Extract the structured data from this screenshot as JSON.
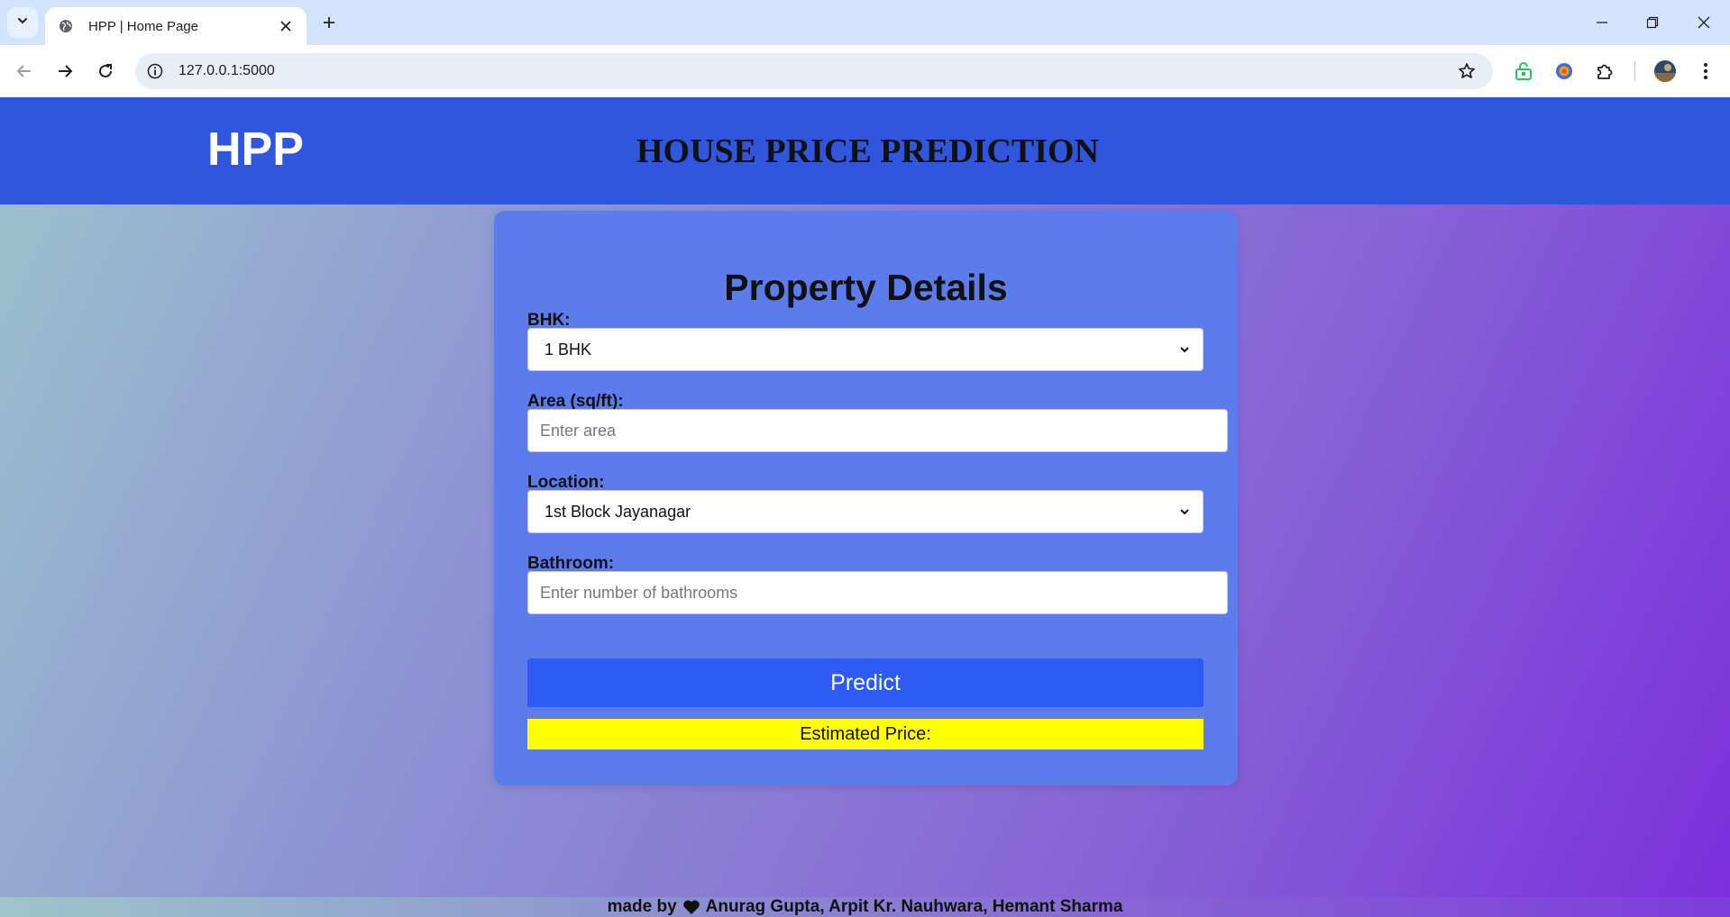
{
  "browser": {
    "tab_title": "HPP | Home Page",
    "url": "127.0.0.1:5000",
    "icons": [
      "tab-search-icon",
      "globe-icon",
      "close-icon",
      "plus-icon",
      "minimize-icon",
      "restore-icon",
      "window-close-icon",
      "back-arrow-icon",
      "forward-arrow-icon",
      "reload-icon",
      "site-info-icon",
      "star-icon",
      "lock-extension-icon",
      "colorful-extension-icon",
      "puzzle-icon",
      "avatar",
      "kebab-menu-icon"
    ]
  },
  "header": {
    "logo": "HPP",
    "title": "HOUSE PRICE PREDICTION",
    "bg_color": "#2f56dd"
  },
  "form": {
    "heading": "Property Details",
    "bhk_label": "BHK:",
    "bhk_value": "1 BHK",
    "area_label": "Area (sq/ft):",
    "area_placeholder": "Enter area",
    "location_label": "Location:",
    "location_value": "1st Block Jayanagar",
    "bathroom_label": "Bathroom:",
    "bathroom_placeholder": "Enter number of bathrooms",
    "predict_label": "Predict",
    "result_text": "Estimated Price:",
    "card_color": "#5b7cea",
    "button_color": "#2d5af2",
    "result_color": "#ffff00"
  },
  "footer": {
    "prefix": "made by",
    "authors": "Anurag Gupta, Arpit Kr. Nauhwara, Hemant Sharma"
  }
}
